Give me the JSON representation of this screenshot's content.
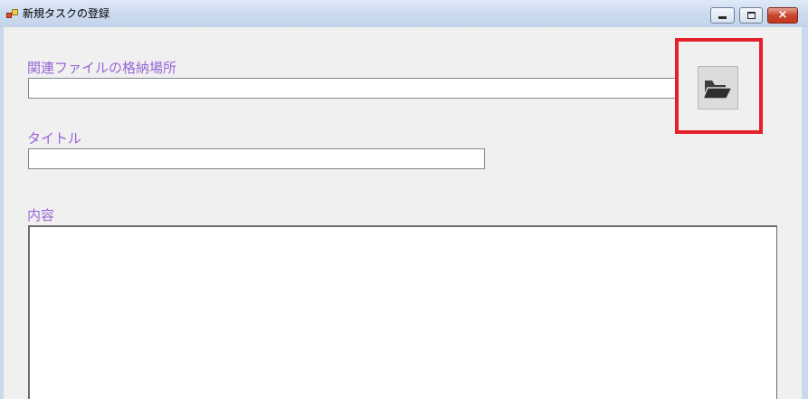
{
  "window": {
    "title": "新規タスクの登録",
    "controls": {
      "minimize_icon": "minimize-icon",
      "maximize_icon": "maximize-icon",
      "close_icon": "close-icon",
      "close_glyph": "×"
    }
  },
  "form": {
    "related_file_label": "関連ファイルの格納場所",
    "related_file_value": "",
    "title_label": "タイトル",
    "title_value": "",
    "content_label": "内容",
    "content_value": ""
  },
  "folder_button": {
    "icon": "folder-open-icon"
  },
  "colors": {
    "label": "#9966d6",
    "highlight": "#e4202a",
    "titlebar": "#cddcef",
    "client_bg": "#f0f0f0"
  }
}
